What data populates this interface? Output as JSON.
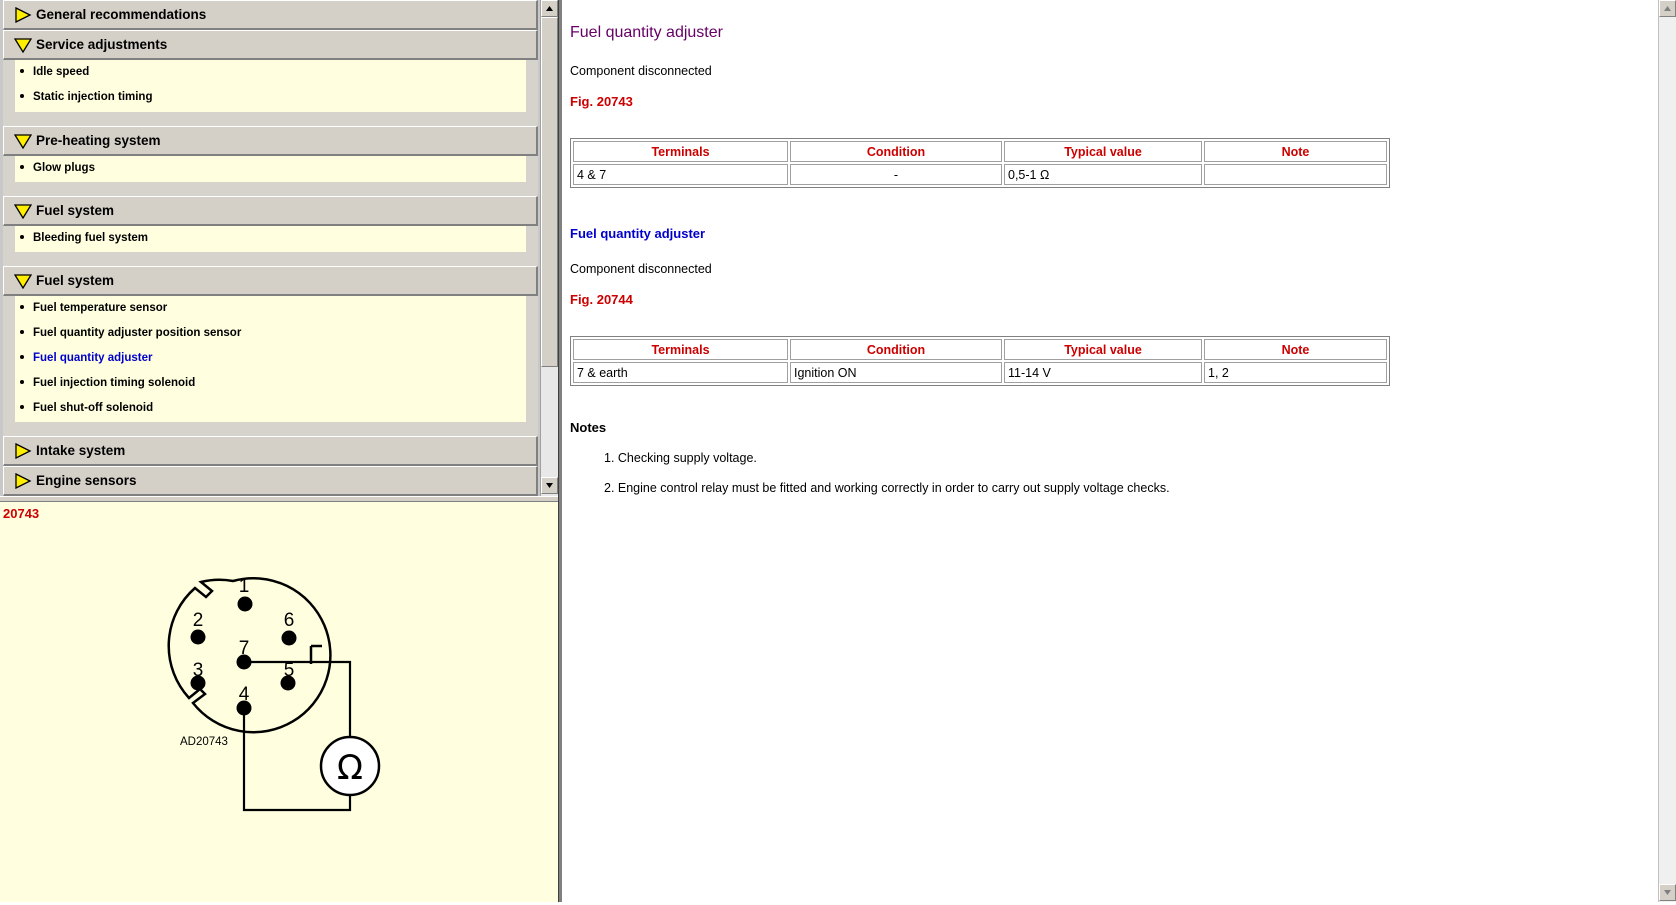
{
  "nav": {
    "sections": [
      {
        "title": "General recommendations",
        "items": []
      },
      {
        "title": "Service adjustments",
        "items": [
          "Idle speed",
          "Static injection timing"
        ]
      },
      {
        "title": "Pre-heating system",
        "items": [
          "Glow plugs"
        ]
      },
      {
        "title": "Fuel system",
        "items": [
          "Bleeding fuel system"
        ]
      },
      {
        "title": "Fuel system",
        "items": [
          "Fuel temperature sensor",
          "Fuel quantity adjuster position sensor",
          "Fuel quantity adjuster",
          "Fuel injection timing solenoid",
          "Fuel shut-off solenoid"
        ]
      },
      {
        "title": "Intake system",
        "items": []
      },
      {
        "title": "Engine sensors",
        "items": []
      }
    ],
    "active_item": "Fuel quantity adjuster"
  },
  "figure": {
    "number": "20743",
    "code": "AD20743",
    "pins": [
      "1",
      "2",
      "3",
      "4",
      "5",
      "6",
      "7"
    ],
    "meter_symbol": "Ω"
  },
  "content": {
    "title": "Fuel quantity adjuster",
    "block1": {
      "condition_text": "Component disconnected",
      "fig_label": "Fig. 20743",
      "table": {
        "headers": [
          "Terminals",
          "Condition",
          "Typical value",
          "Note"
        ],
        "row": [
          "4 & 7",
          "-",
          "0,5-1 Ω",
          ""
        ]
      }
    },
    "block2": {
      "subtitle": "Fuel quantity adjuster",
      "condition_text": "Component disconnected",
      "fig_label": "Fig. 20744",
      "table": {
        "headers": [
          "Terminals",
          "Condition",
          "Typical value",
          "Note"
        ],
        "row": [
          "7 & earth",
          "Ignition ON",
          "11-14 V",
          "1, 2"
        ]
      }
    },
    "notes_heading": "Notes",
    "notes": [
      "1. Checking supply voltage.",
      "2. Engine control relay must be fitted and working correctly in order to carry out supply voltage checks."
    ]
  },
  "colors": {
    "title": "#660066",
    "subtitle": "#0000cc",
    "fig_label": "#cc0000",
    "highlight_bg": "#ffffe0",
    "header_arrow": "#ffee00"
  }
}
